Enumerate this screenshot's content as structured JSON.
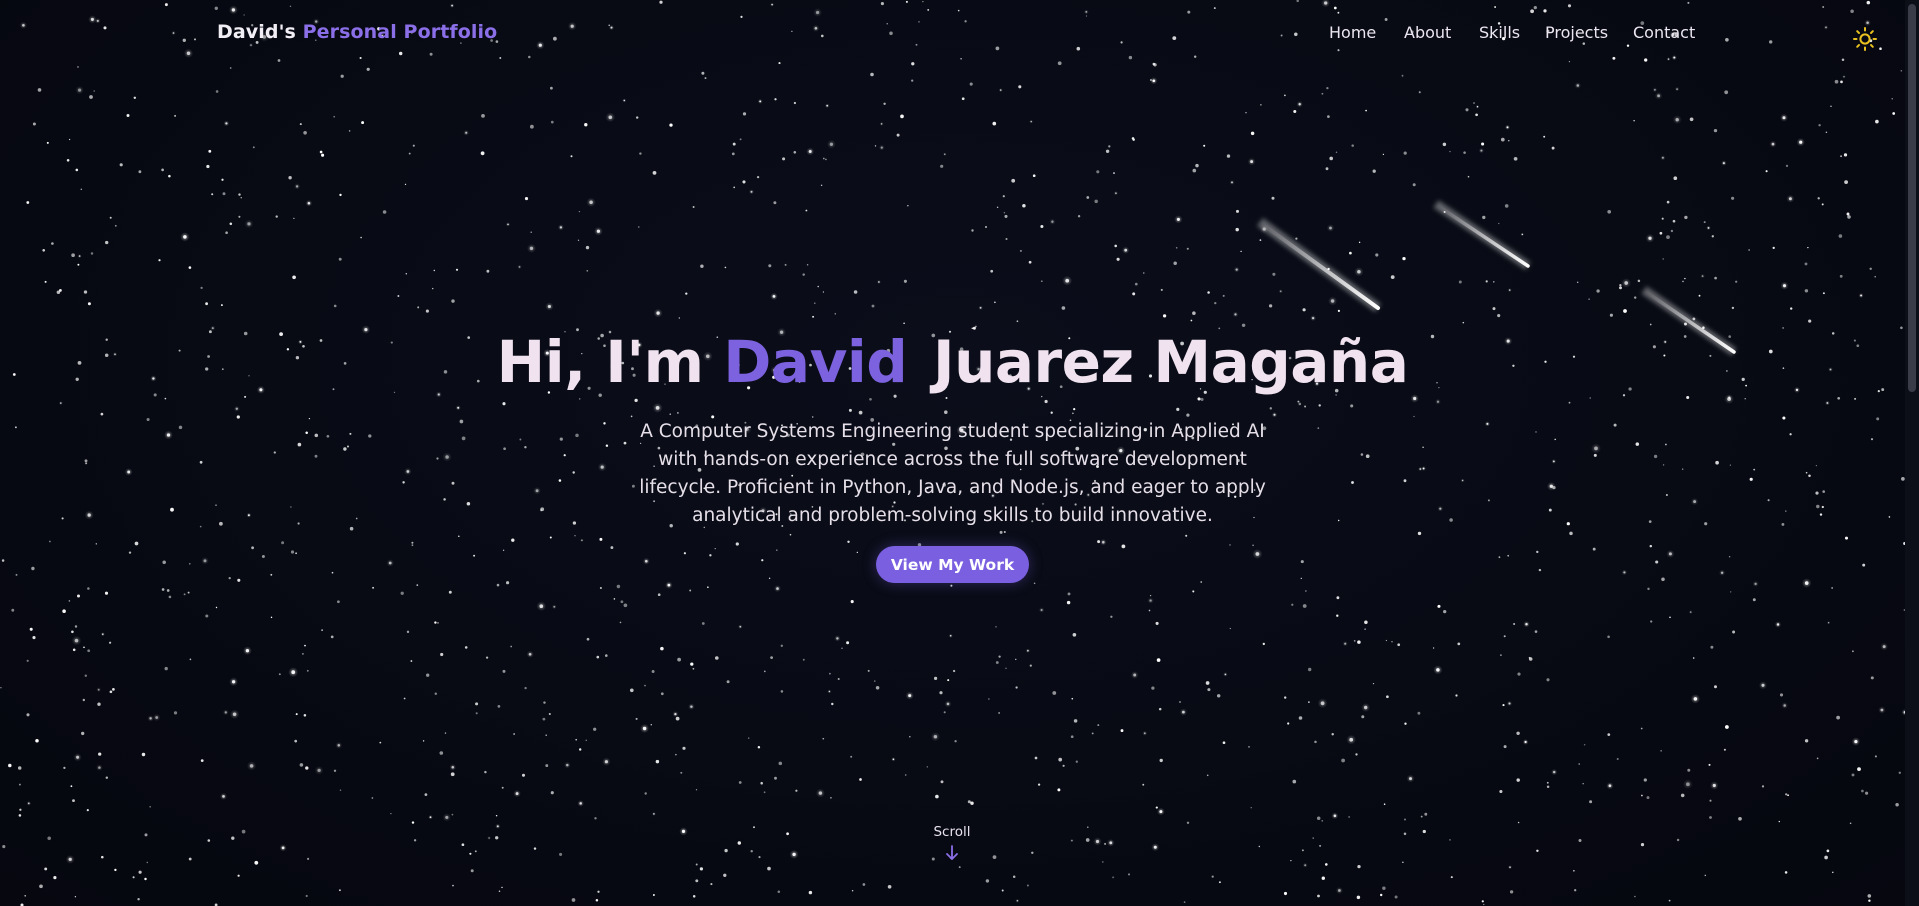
{
  "brand": {
    "owner": "David's",
    "title": "Personal Portfolio"
  },
  "nav": {
    "links": [
      "Home",
      "About",
      "Skills",
      "Projects",
      "Contact"
    ]
  },
  "theme_toggle": {
    "icon": "sun-icon",
    "color": "#e8c020"
  },
  "hero": {
    "greeting": "Hi, I'm",
    "first_name": "David",
    "last_name": "Juarez Magaña",
    "description": "A Computer Systems Engineering student specializing in Applied AI with hands-on experience across the full software development lifecycle. Proficient in Python, Java, and Node.js, and eager to apply analytical and problem-solving skills to build innovative.",
    "cta_label": "View My Work"
  },
  "scroll": {
    "label": "Scroll",
    "icon": "arrow-down-icon"
  },
  "colors": {
    "background": "#080a14",
    "accent": "#7c62de",
    "heading": "#f0e2ee",
    "button": "#7a5fe0"
  }
}
